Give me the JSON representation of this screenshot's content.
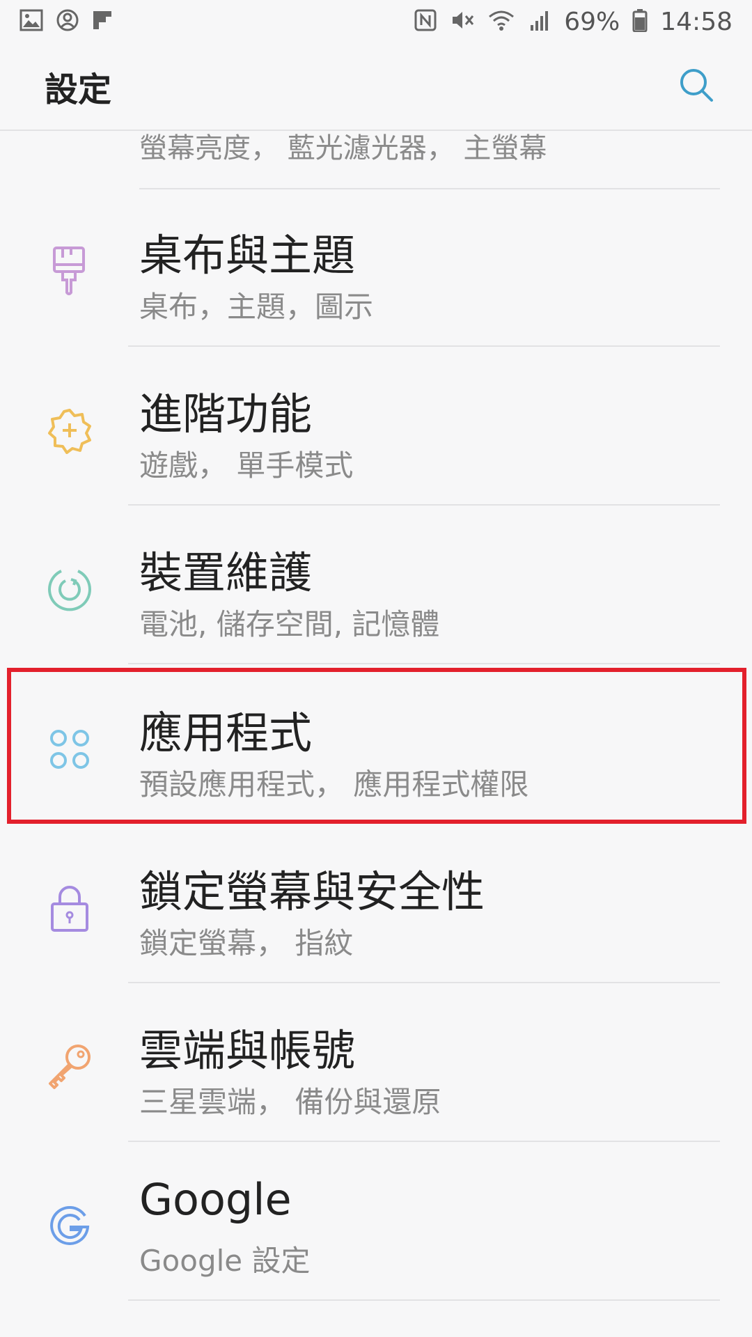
{
  "status_bar": {
    "battery_percent": "69%",
    "time": "14:58",
    "icons_left": [
      "gallery-icon",
      "account-icon",
      "flipboard-icon"
    ],
    "icons_right": [
      "nfc-icon",
      "mute-icon",
      "wifi-icon",
      "signal-icon",
      "battery-icon"
    ]
  },
  "app_bar": {
    "title": "設定",
    "search_icon": "search-icon"
  },
  "partial_item": {
    "subtitle": "螢幕亮度， 藍光濾光器， 主螢幕"
  },
  "items": [
    {
      "title": "桌布與主題",
      "subtitle": "桌布，主題，圖示",
      "icon": "paintbrush-icon",
      "color": "#c79ad6"
    },
    {
      "title": "進階功能",
      "subtitle": "遊戲， 單手模式",
      "icon": "gear-plus-icon",
      "color": "#efbe58"
    },
    {
      "title": "裝置維護",
      "subtitle": "電池, 儲存空間, 記憶體",
      "icon": "refresh-circle-icon",
      "color": "#7fcbb8"
    },
    {
      "title": "應用程式",
      "subtitle": "預設應用程式， 應用程式權限",
      "icon": "apps-grid-icon",
      "color": "#7ec5e6"
    },
    {
      "title": "鎖定螢幕與安全性",
      "subtitle": "鎖定螢幕， 指紋",
      "icon": "lock-icon",
      "color": "#a58be0"
    },
    {
      "title": "雲端與帳號",
      "subtitle": "三星雲端， 備份與還原",
      "icon": "key-icon",
      "color": "#f1a470"
    },
    {
      "title": "Google",
      "subtitle": "Google 設定",
      "icon": "google-icon",
      "color": "#6c9ee8"
    }
  ],
  "highlight_color": "#e3202c"
}
